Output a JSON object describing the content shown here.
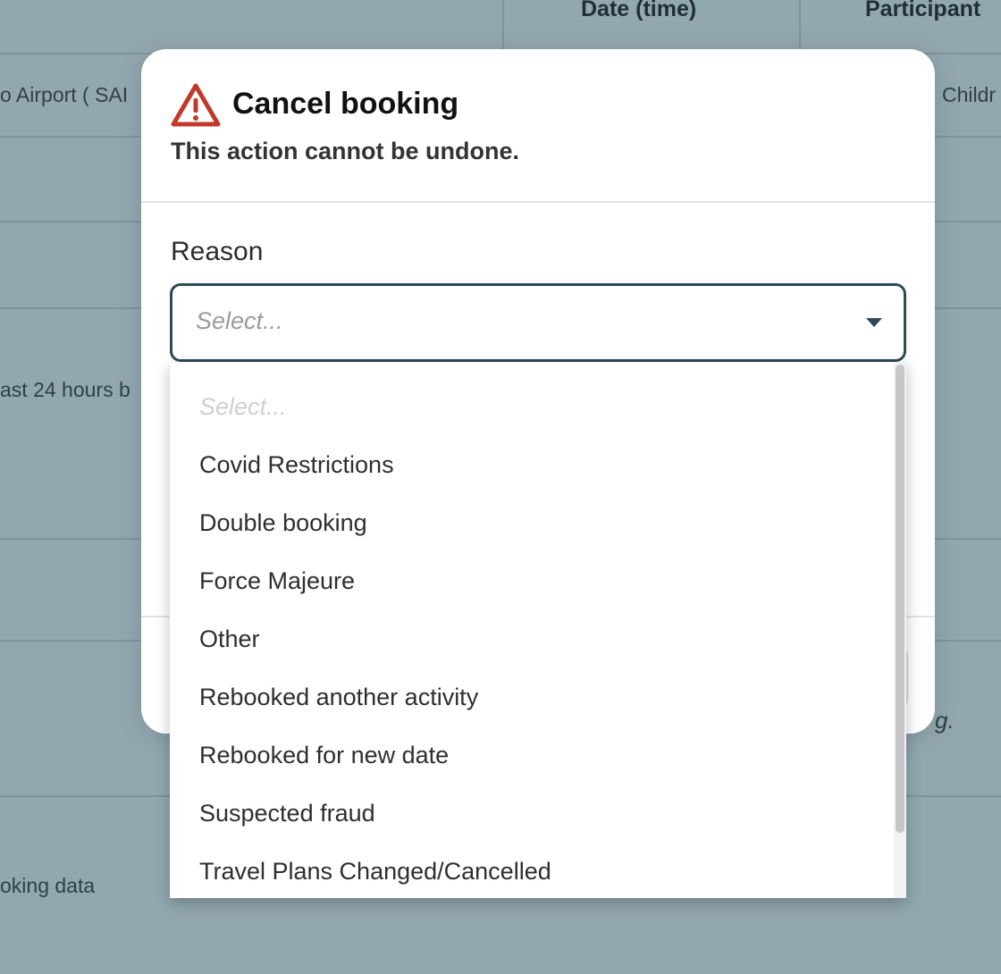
{
  "background": {
    "columns": [
      {
        "label": "Date (time)"
      },
      {
        "label": "Participant"
      }
    ],
    "cells": {
      "row1_location": "o Airport ( SAI",
      "row1_participants": "Childr",
      "row3_text": "ast 24 hours b",
      "row5_italic": "g.",
      "row6_text": "oking data"
    }
  },
  "modal": {
    "title": "Cancel booking",
    "subtitle": "This action cannot be undone.",
    "icon": "warning-triangle-icon",
    "reason": {
      "label": "Reason",
      "placeholder": "Select..."
    }
  },
  "dropdown": {
    "options": [
      {
        "label": "Select...",
        "placeholder": true
      },
      {
        "label": "Covid Restrictions"
      },
      {
        "label": "Double booking"
      },
      {
        "label": "Force Majeure"
      },
      {
        "label": "Other"
      },
      {
        "label": "Rebooked another activity"
      },
      {
        "label": "Rebooked for new date"
      },
      {
        "label": "Suspected fraud"
      },
      {
        "label": "Travel Plans Changed/Cancelled"
      }
    ]
  },
  "colors": {
    "warning": "#c0392b",
    "select_border": "#2c4a57",
    "overlay": "#92a8b0"
  }
}
